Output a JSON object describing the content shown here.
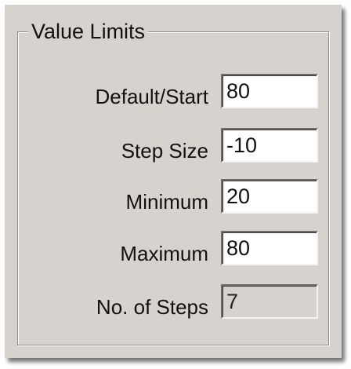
{
  "group": {
    "title": "Value Limits"
  },
  "fields": {
    "default_start": {
      "label": "Default/Start",
      "value": "80"
    },
    "step_size": {
      "label": "Step Size",
      "value": "-10"
    },
    "minimum": {
      "label": "Minimum",
      "value": "20"
    },
    "maximum": {
      "label": "Maximum",
      "value": "80"
    },
    "num_steps": {
      "label": "No. of Steps",
      "value": "7",
      "editable": false
    }
  },
  "colors": {
    "panel_background": "#d6d3ce",
    "field_background": "#ffffff",
    "text": "#111111"
  }
}
